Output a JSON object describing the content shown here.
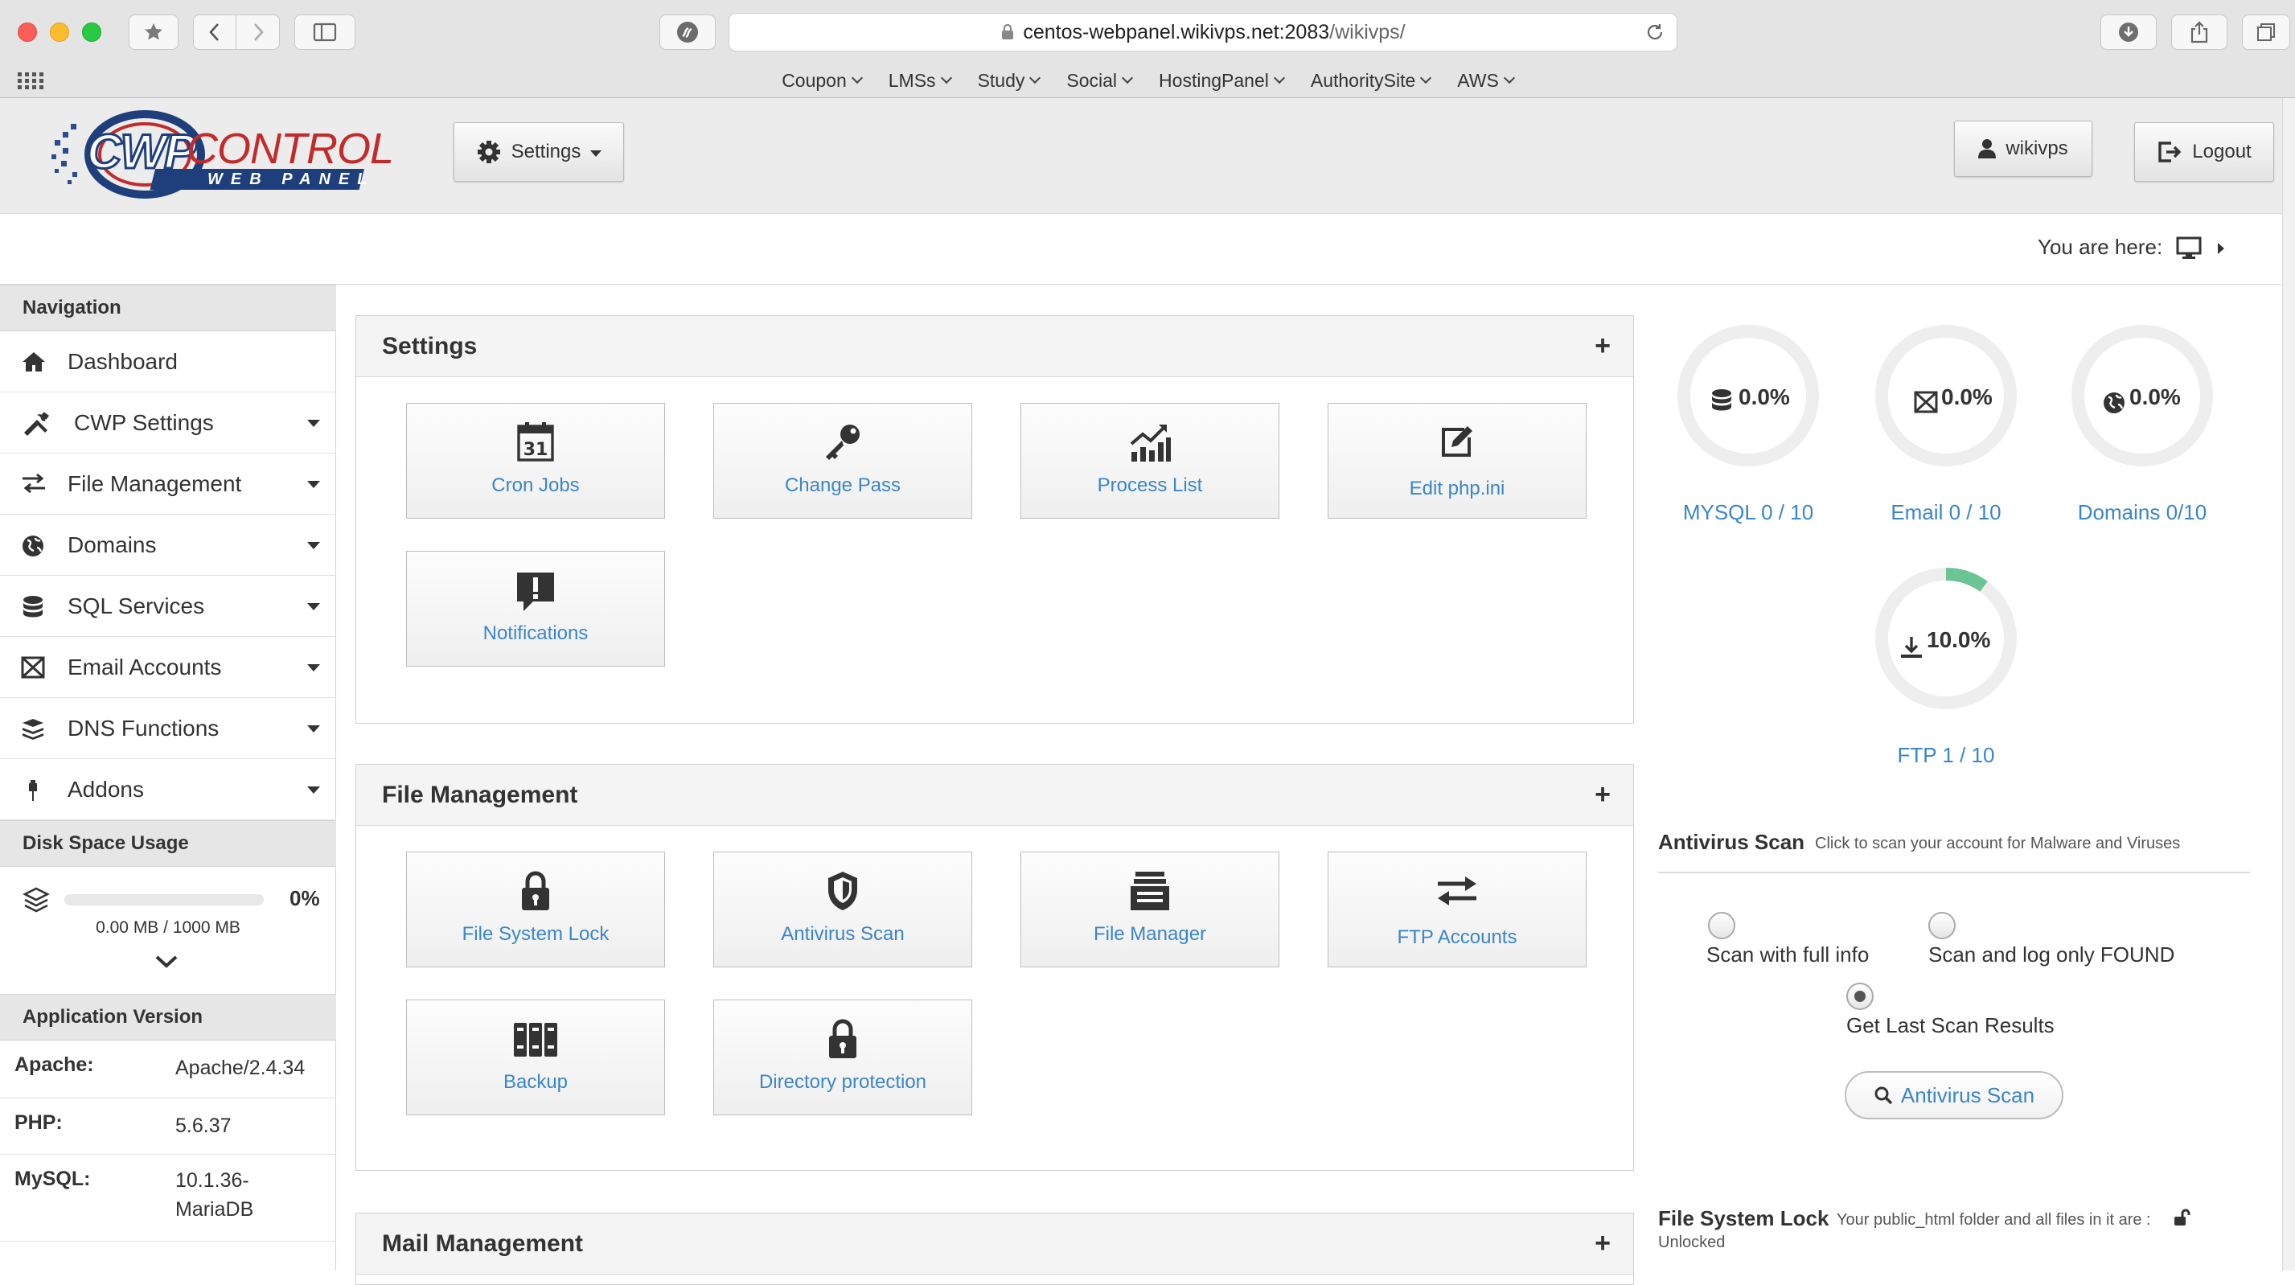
{
  "browser": {
    "url_host": "centos-webpanel.wikivps.net:2083",
    "url_path": "/wikivps/",
    "favorites": [
      "Coupon",
      "LMSs",
      "Study",
      "Social",
      "HostingPanel",
      "AuthoritySite",
      "AWS"
    ]
  },
  "header": {
    "logo_main": "CWP",
    "logo_control": "CONTROL",
    "logo_sub": "WEB PANEL",
    "settings_label": "Settings",
    "user_label": "wikivps",
    "logout_label": "Logout"
  },
  "breadcrumb": {
    "label": "You are here:"
  },
  "sidebar": {
    "nav_title": "Navigation",
    "items": [
      {
        "label": "Dashboard",
        "icon": "home-icon",
        "dropdown": false
      },
      {
        "label": "CWP Settings",
        "icon": "tools-icon",
        "dropdown": true
      },
      {
        "label": "File Management",
        "icon": "transfer-icon",
        "dropdown": true
      },
      {
        "label": "Domains",
        "icon": "globe-icon",
        "dropdown": true
      },
      {
        "label": "SQL Services",
        "icon": "database-icon",
        "dropdown": true
      },
      {
        "label": "Email Accounts",
        "icon": "envelope-icon",
        "dropdown": true
      },
      {
        "label": "DNS Functions",
        "icon": "stack-icon",
        "dropdown": true
      },
      {
        "label": "Addons",
        "icon": "plug-icon",
        "dropdown": true
      }
    ],
    "disk": {
      "title": "Disk Space Usage",
      "percent_label": "0%",
      "percent": 0,
      "usage": "0.00 MB / 1000 MB"
    },
    "app_version": {
      "title": "Application Version",
      "rows": [
        {
          "key": "Apache:",
          "value": "Apache/2.4.34"
        },
        {
          "key": "PHP:",
          "value": "5.6.37"
        },
        {
          "key": "MySQL:",
          "value": "10.1.36-\nMariaDB"
        }
      ]
    }
  },
  "panels": {
    "settings": {
      "title": "Settings",
      "tiles": [
        {
          "label": "Cron Jobs",
          "icon": "calendar-icon"
        },
        {
          "label": "Change Pass",
          "icon": "key-icon"
        },
        {
          "label": "Process List",
          "icon": "bar-chart-icon"
        },
        {
          "label": "Edit php.ini",
          "icon": "edit-icon"
        },
        {
          "label": "Notifications",
          "icon": "alert-icon"
        }
      ]
    },
    "file_management": {
      "title": "File Management",
      "tiles": [
        {
          "label": "File System Lock",
          "icon": "lock-icon"
        },
        {
          "label": "Antivirus Scan",
          "icon": "shield-icon"
        },
        {
          "label": "File Manager",
          "icon": "inbox-icon"
        },
        {
          "label": "FTP Accounts",
          "icon": "exchange-icon"
        },
        {
          "label": "Backup",
          "icon": "archive-icon"
        },
        {
          "label": "Directory protection",
          "icon": "lock-icon"
        }
      ]
    },
    "mail_management": {
      "title": "Mail Management"
    }
  },
  "stats": [
    {
      "value": "0.0%",
      "label": "MYSQL 0 / 10",
      "fraction": 0.0,
      "icon": "database-icon"
    },
    {
      "value": "0.0%",
      "label": "Email 0 / 10",
      "fraction": 0.0,
      "icon": "envelope-icon"
    },
    {
      "value": "0.0%",
      "label": "Domains 0/10",
      "fraction": 0.0,
      "icon": "globe-icon"
    },
    {
      "value": "10.0%",
      "label": "FTP 1 / 10",
      "fraction": 0.1,
      "icon": "download-icon"
    }
  ],
  "colors": {
    "accent": "#3a86c8",
    "ring_track": "#eeeeee",
    "ring_fill": "#6cc495"
  },
  "antivirus": {
    "title": "Antivirus Scan",
    "subtitle": "Click to scan your account for Malware and Viruses",
    "options": [
      {
        "label": "Scan with full info",
        "checked": false
      },
      {
        "label": "Scan and log only FOUND",
        "checked": false
      },
      {
        "label": "Get Last Scan Results",
        "checked": true
      }
    ],
    "button": "Antivirus Scan"
  },
  "fs_lock": {
    "title": "File System Lock",
    "subtitle": "Your public_html folder and all files in it are :",
    "status": "Unlocked"
  }
}
